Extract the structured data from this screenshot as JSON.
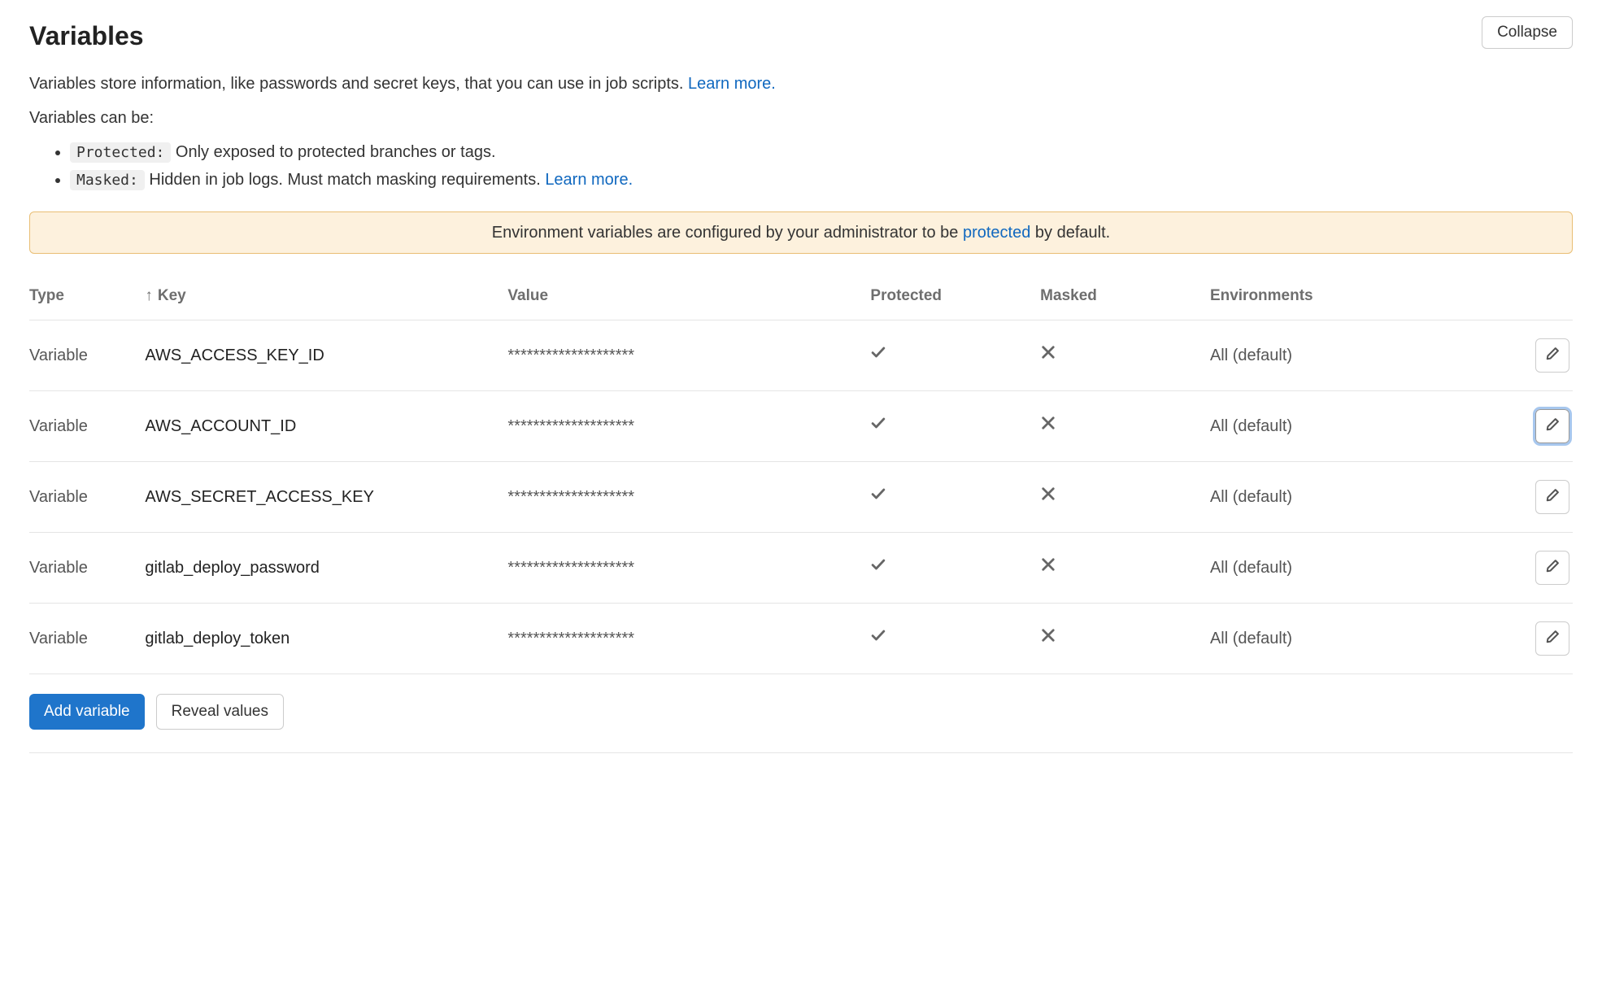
{
  "header": {
    "title": "Variables",
    "collapse_label": "Collapse"
  },
  "description": {
    "intro_prefix": "Variables store information, like passwords and secret keys, that you can use in job scripts. ",
    "learn_more": "Learn more.",
    "can_be": "Variables can be:",
    "protected_label": "Protected:",
    "protected_desc": " Only exposed to protected branches or tags.",
    "masked_label": "Masked:",
    "masked_desc": " Hidden in job logs. Must match masking requirements. ",
    "masked_learn_more": "Learn more."
  },
  "alert": {
    "prefix": "Environment variables are configured by your administrator to be ",
    "link": "protected",
    "suffix": " by default."
  },
  "table": {
    "headers": {
      "type": "Type",
      "key": "Key",
      "value": "Value",
      "protected": "Protected",
      "masked": "Masked",
      "environments": "Environments"
    },
    "sort_indicator": "↑",
    "rows": [
      {
        "type": "Variable",
        "key": "AWS_ACCESS_KEY_ID",
        "value": "********************",
        "protected": true,
        "masked": false,
        "environments": "All (default)",
        "focused": false
      },
      {
        "type": "Variable",
        "key": "AWS_ACCOUNT_ID",
        "value": "********************",
        "protected": true,
        "masked": false,
        "environments": "All (default)",
        "focused": true
      },
      {
        "type": "Variable",
        "key": "AWS_SECRET_ACCESS_KEY",
        "value": "********************",
        "protected": true,
        "masked": false,
        "environments": "All (default)",
        "focused": false
      },
      {
        "type": "Variable",
        "key": "gitlab_deploy_password",
        "value": "********************",
        "protected": true,
        "masked": false,
        "environments": "All (default)",
        "focused": false
      },
      {
        "type": "Variable",
        "key": "gitlab_deploy_token",
        "value": "********************",
        "protected": true,
        "masked": false,
        "environments": "All (default)",
        "focused": false
      }
    ]
  },
  "footer": {
    "add_variable": "Add variable",
    "reveal_values": "Reveal values"
  }
}
